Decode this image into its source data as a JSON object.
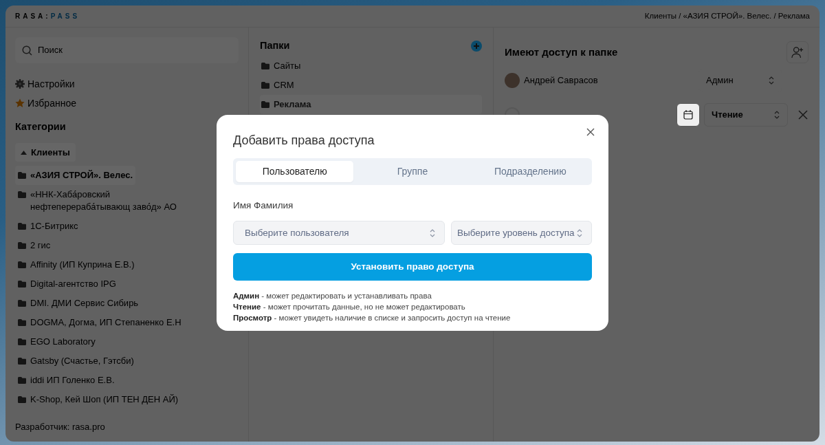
{
  "header": {
    "logo": {
      "text": "RASA:",
      "accent": "PASS"
    },
    "breadcrumb": "Клиенты / «АЗИЯ СТРОЙ». Велес. / Реклама"
  },
  "sidebar": {
    "search": {
      "placeholder": "Поиск"
    },
    "menu": [
      {
        "label": "Настройки",
        "kind": "settings"
      },
      {
        "label": "Избранное",
        "kind": "favorites"
      }
    ],
    "categories_title": "Категории",
    "category": {
      "label": "Клиенты",
      "expanded": true
    },
    "clients": [
      {
        "label": "«АЗИЯ СТРОЙ». Велес.",
        "selected": true
      },
      {
        "label": "«ННК-Хаба́ровский нефтеперераба́тывающ заво́д» АО",
        "selected": false
      },
      {
        "label": "1С-Битрикс",
        "selected": false
      },
      {
        "label": "2 гис",
        "selected": false
      },
      {
        "label": "Affinity (ИП Куприна Е.В.)",
        "selected": false
      },
      {
        "label": "Digital-агентство IPG",
        "selected": false
      },
      {
        "label": "DMI. ДМИ Сервис Сибирь",
        "selected": false
      },
      {
        "label": "DOGMA, Догма, ИП Степаненко Е.Н",
        "selected": false
      },
      {
        "label": "EGO Laboratory",
        "selected": false
      },
      {
        "label": "Gatsby (Счастье, Гэтсби)",
        "selected": false
      },
      {
        "label": "iddi ИП Голенко Е.В.",
        "selected": false
      },
      {
        "label": "K-Shop, Кей Шоп (ИП ТЕН ДЕН АЙ)",
        "selected": false
      }
    ],
    "footer": "Разработчик: rasa.pro"
  },
  "folders": {
    "title": "Папки",
    "items": [
      {
        "label": "Сайты",
        "selected": false
      },
      {
        "label": "CRM",
        "selected": false
      },
      {
        "label": "Реклама",
        "selected": true
      }
    ]
  },
  "access": {
    "title": "Имеют доступ к папке",
    "users": [
      {
        "name": "Андрей Саврасов",
        "role": "Админ",
        "editable": false
      },
      {
        "role": "Чтение",
        "editable": true
      }
    ]
  },
  "modal": {
    "title": "Добавить права доступа",
    "tabs": [
      {
        "label": "Пользователю",
        "selected": true
      },
      {
        "label": "Группе",
        "selected": false
      },
      {
        "label": "Подразделению",
        "selected": false
      }
    ],
    "field_label": "Имя Фамилия",
    "selects": [
      {
        "placeholder": "Выберите пользователя"
      },
      {
        "placeholder": "Выберите уровень доступа"
      }
    ],
    "button": "Установить право доступа",
    "legend": [
      "**Админ** - может редактировать и устанавливать права",
      "**Чтение** - может прочитать данные, но не может редактировать",
      "**Просмотр** - может увидеть наличие в списке и запросить доступ на чтение"
    ]
  }
}
